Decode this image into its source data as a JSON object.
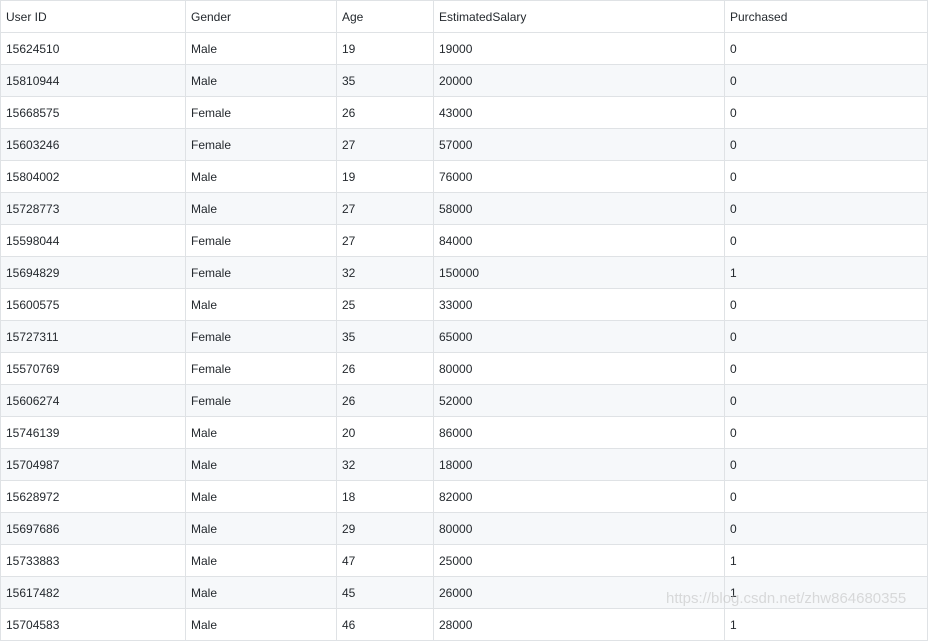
{
  "table": {
    "headers": [
      "User ID",
      "Gender",
      "Age",
      "EstimatedSalary",
      "Purchased"
    ],
    "rows": [
      [
        "15624510",
        "Male",
        "19",
        "19000",
        "0"
      ],
      [
        "15810944",
        "Male",
        "35",
        "20000",
        "0"
      ],
      [
        "15668575",
        "Female",
        "26",
        "43000",
        "0"
      ],
      [
        "15603246",
        "Female",
        "27",
        "57000",
        "0"
      ],
      [
        "15804002",
        "Male",
        "19",
        "76000",
        "0"
      ],
      [
        "15728773",
        "Male",
        "27",
        "58000",
        "0"
      ],
      [
        "15598044",
        "Female",
        "27",
        "84000",
        "0"
      ],
      [
        "15694829",
        "Female",
        "32",
        "150000",
        "1"
      ],
      [
        "15600575",
        "Male",
        "25",
        "33000",
        "0"
      ],
      [
        "15727311",
        "Female",
        "35",
        "65000",
        "0"
      ],
      [
        "15570769",
        "Female",
        "26",
        "80000",
        "0"
      ],
      [
        "15606274",
        "Female",
        "26",
        "52000",
        "0"
      ],
      [
        "15746139",
        "Male",
        "20",
        "86000",
        "0"
      ],
      [
        "15704987",
        "Male",
        "32",
        "18000",
        "0"
      ],
      [
        "15628972",
        "Male",
        "18",
        "82000",
        "0"
      ],
      [
        "15697686",
        "Male",
        "29",
        "80000",
        "0"
      ],
      [
        "15733883",
        "Male",
        "47",
        "25000",
        "1"
      ],
      [
        "15617482",
        "Male",
        "45",
        "26000",
        "1"
      ],
      [
        "15704583",
        "Male",
        "46",
        "28000",
        "1"
      ]
    ]
  },
  "watermark": "https://blog.csdn.net/zhw864680355"
}
